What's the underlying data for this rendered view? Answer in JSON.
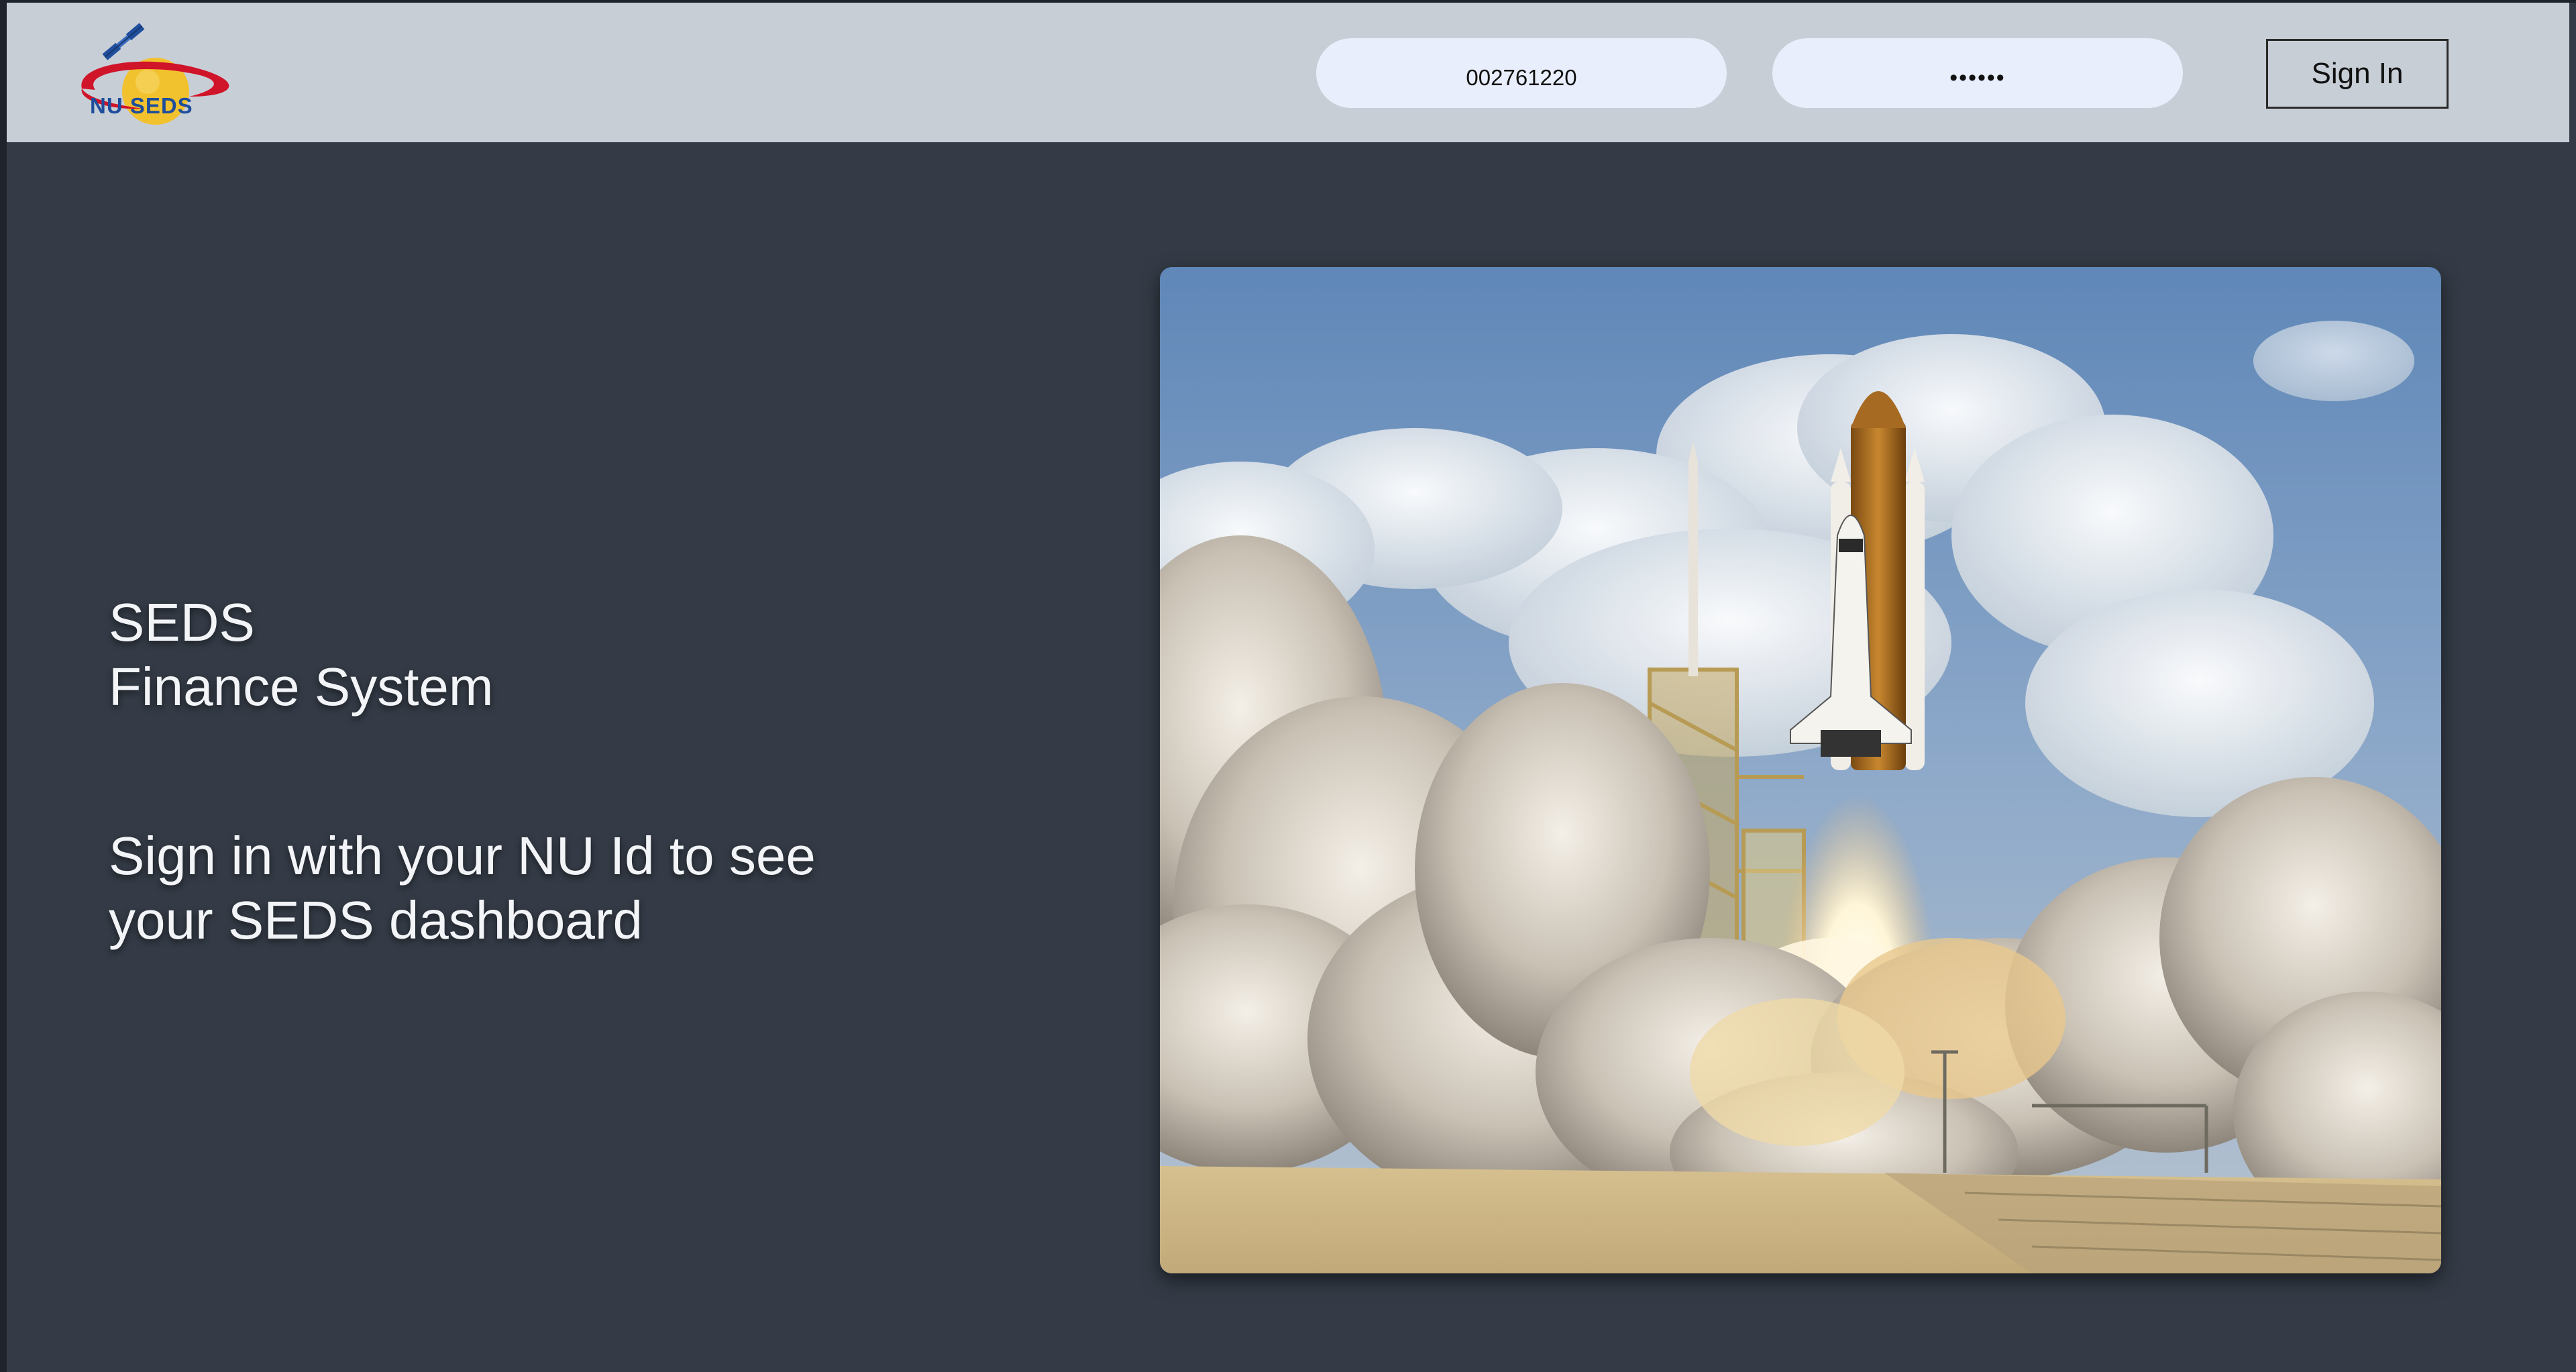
{
  "header": {
    "logo_text": "NU SEDS",
    "username_value": "002761220",
    "password_value": "••••••",
    "signin_label": "Sign In"
  },
  "main": {
    "title_line1": "SEDS",
    "title_line2": "Finance System",
    "subtitle_line1": "Sign in with your NU Id to see",
    "subtitle_line2": "your SEDS dashboard"
  },
  "icons": {
    "logo": "satellite-orbit-logo",
    "hero": "space-shuttle-launch-image"
  },
  "colors": {
    "background": "#343b46",
    "header": "#c8ced6",
    "input": "#e8eefb",
    "logo_red": "#d0142a",
    "logo_gold": "#f2c12e",
    "logo_blue": "#1e4e9c"
  }
}
